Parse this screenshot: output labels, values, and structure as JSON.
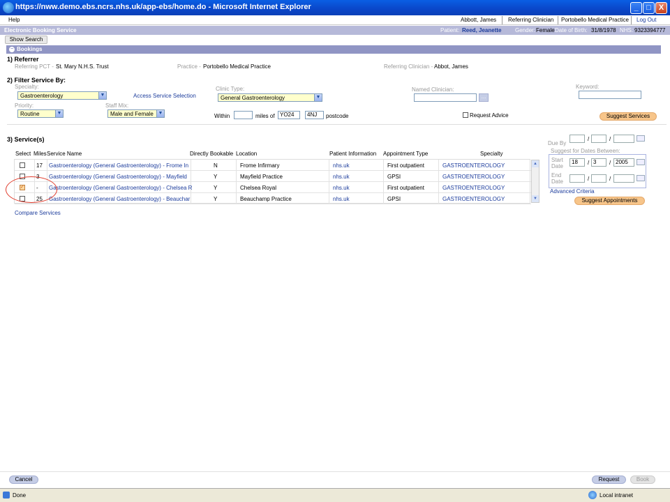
{
  "window": {
    "title": "https://nww.demo.ebs.ncrs.nhs.uk/app-ebs/home.do - Microsoft Internet Explorer",
    "min": "_",
    "max": "□",
    "close": "X"
  },
  "menubar": {
    "help": "Help",
    "user": "Abbott, James",
    "role": "Referring Clinician",
    "practice": "Portobello Medical Practice",
    "logout": "Log Out"
  },
  "ebs": {
    "title": "Electronic Booking Service",
    "patient_label": "Patient:",
    "patient_name": "Reed, Jeanette",
    "gender_label": "Gender:",
    "gender": "Female",
    "dob_label": "Date of Birth:",
    "dob": "31/8/1978",
    "nhs_label": "NHS:",
    "nhs": "9323394777"
  },
  "show_search": "Show Search",
  "bookings": {
    "icon": "−",
    "title": "Bookings"
  },
  "referrer": {
    "heading": "1) Referrer",
    "pct_label": "Referring PCT -",
    "pct": "St. Mary N.H.S. Trust",
    "practice_label": "Practice -",
    "practice": "Portobello Medical Practice",
    "clinician_label": "Referring Clinician -",
    "clinician": "Abbot, James"
  },
  "filter": {
    "heading": "2) Filter Service By:",
    "specialty_label": "Specialty:",
    "specialty": "Gastroenterology",
    "access_link": "Access Service Selection",
    "clinic_label": "Clinic Type:",
    "clinic": "General Gastroenterology",
    "named_label": "Named Clinician:",
    "named_btn": "...",
    "keyword_label": "Keyword:",
    "priority_label": "Priority:",
    "priority": "Routine",
    "staff_label": "Staff Mix:",
    "staff": "Male and Female",
    "within": "Within",
    "miles_of": "miles of",
    "pc1": "YO24",
    "pc2": "4NJ",
    "postcode": "postcode",
    "request_advice": "Request Advice",
    "suggest_services": "Suggest Services"
  },
  "services": {
    "heading": "3) Service(s)",
    "columns": [
      "Select",
      "Miles",
      "Service Name",
      "Directly Bookable",
      "Location",
      "Patient Information",
      "Appointment Type",
      "Specialty"
    ],
    "rows": [
      {
        "miles": "17",
        "name": "Gastroenterology (General Gastroenterology) - Frome In",
        "bookable": "N",
        "location": "Frome Infirmary",
        "info": "nhs.uk",
        "appt": "First outpatient",
        "specialty": "GASTROENTEROLOGY",
        "checked": false
      },
      {
        "miles": "3",
        "name": "Gastroenterology (General Gastroenterology) - Mayfield",
        "bookable": "Y",
        "location": "Mayfield Practice",
        "info": "nhs.uk",
        "appt": "GPSI",
        "specialty": "GASTROENTEROLOGY",
        "checked": false
      },
      {
        "miles": "-",
        "name": "Gastroenterology (General Gastroenterology) - Chelsea R",
        "bookable": "Y",
        "location": "Chelsea Royal",
        "info": "nhs.uk",
        "appt": "First outpatient",
        "specialty": "GASTROENTEROLOGY",
        "checked": true
      },
      {
        "miles": "25",
        "name": "Gastroenterology (General Gastroenterology) - Beauchar",
        "bookable": "Y",
        "location": "Beauchamp Practice",
        "info": "nhs.uk",
        "appt": "GPSI",
        "specialty": "GASTROENTEROLOGY",
        "checked": false
      }
    ],
    "compare": "Compare Services"
  },
  "dates": {
    "due_by": "Due By",
    "suggest_between": "Suggest for Dates Between:",
    "start": "Start Date",
    "start_d": "18",
    "start_m": "3",
    "start_y": "2005",
    "end": "End Date",
    "slash": "/",
    "advanced": "Advanced Criteria",
    "suggest_appts": "Suggest Appointments"
  },
  "bottom": {
    "cancel": "Cancel",
    "request": "Request",
    "book": "Book"
  },
  "status": {
    "done": "Done",
    "zone": "Local intranet"
  },
  "colors": {
    "title_blue": "#0a46c8",
    "bar": "#b6b9d9",
    "bookings": "#9095c4",
    "orange_btn": "#f7c58a",
    "highlight": "#e03a2a"
  }
}
